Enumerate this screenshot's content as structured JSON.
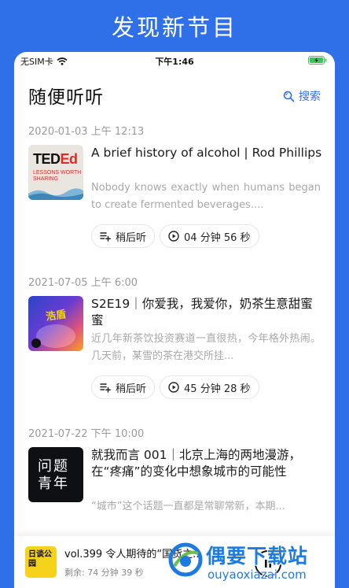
{
  "banner": {
    "title": "发现新节目"
  },
  "status_bar": {
    "carrier": "无SIM卡",
    "time": "下午1:46"
  },
  "header": {
    "title": "随便听听",
    "search_label": "搜索"
  },
  "episodes": [
    {
      "date": "2020-01-03 上午 12:13",
      "cover": {
        "text_brand": "TED",
        "text_brand_suffix": "Ed",
        "text_tagline": "LESSONS WORTH SHARING"
      },
      "title": "A brief history of alcohol | Rod Phillips",
      "description": "Nobody knows exactly when humans began to create fermented beverages....",
      "later_label": "稍后听",
      "duration": "04 分钟 56 秒"
    },
    {
      "date": "2021-07-05 上午 6:00",
      "cover": {
        "tag": "浩盾"
      },
      "title": "S2E19｜你爱我，我爱你，奶茶生意甜蜜蜜",
      "description": "近几年新茶饮投资赛道一直很热，今年格外热闹。几天前，某雪的茶在港交所挂...",
      "later_label": "稍后听",
      "duration": "45 分钟 28 秒"
    },
    {
      "date": "2021-07-22 下午 10:00",
      "cover": {
        "text": "问题青年"
      },
      "title": "就我而言 001｜北京上海的两地漫游，在“疼痛”的变化中想象城市的可能性",
      "description": "“城市”这个话题一直都是常聊常新，本期..."
    }
  ],
  "player": {
    "cover_text": "日谈公园",
    "title": "vol.399 令人期待的“国货之...",
    "remaining": "剩余: 74 分钟 39 秒"
  },
  "watermark": {
    "text": "偶要下载站",
    "url": "ouyaoxiazai.com"
  },
  "colors": {
    "accent": "#2f6fe8",
    "muted": "#9a9a9a"
  }
}
